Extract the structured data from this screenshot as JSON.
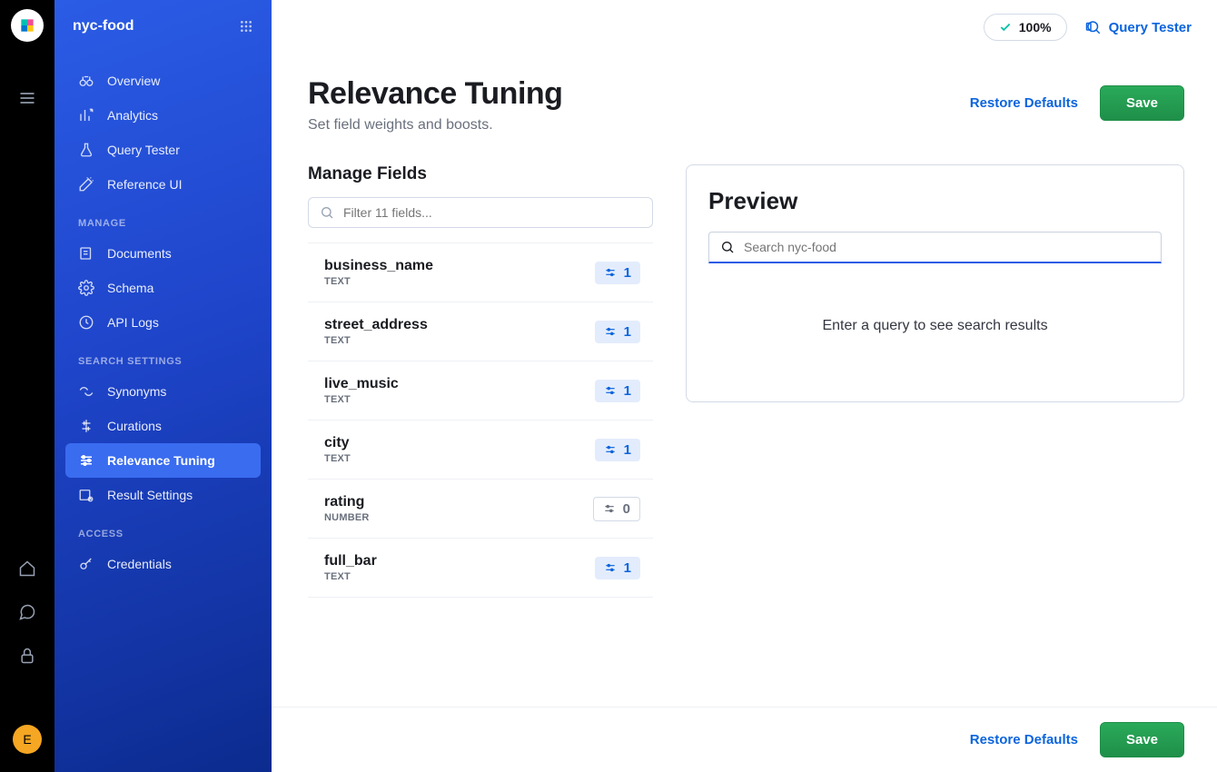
{
  "app_name": "nyc-food",
  "avatar_initial": "E",
  "topbar": {
    "pill_pct": "100%",
    "query_tester": "Query Tester"
  },
  "page": {
    "title": "Relevance Tuning",
    "subtitle": "Set field weights and boosts.",
    "restore": "Restore Defaults",
    "save": "Save"
  },
  "manage_fields": {
    "heading": "Manage Fields",
    "filter_placeholder": "Filter 11 fields...",
    "fields": [
      {
        "name": "business_name",
        "type": "TEXT",
        "weight": "1",
        "style": "blue"
      },
      {
        "name": "street_address",
        "type": "TEXT",
        "weight": "1",
        "style": "blue"
      },
      {
        "name": "live_music",
        "type": "TEXT",
        "weight": "1",
        "style": "blue"
      },
      {
        "name": "city",
        "type": "TEXT",
        "weight": "1",
        "style": "blue"
      },
      {
        "name": "rating",
        "type": "NUMBER",
        "weight": "0",
        "style": "gray"
      },
      {
        "name": "full_bar",
        "type": "TEXT",
        "weight": "1",
        "style": "blue"
      }
    ]
  },
  "preview": {
    "heading": "Preview",
    "placeholder": "Search nyc-food",
    "empty": "Enter a query to see search results"
  },
  "sidebar": {
    "top": [
      {
        "label": "Overview",
        "icon": "binoculars"
      },
      {
        "label": "Analytics",
        "icon": "analytics"
      },
      {
        "label": "Query Tester",
        "icon": "flask"
      },
      {
        "label": "Reference UI",
        "icon": "wand"
      }
    ],
    "groups": [
      {
        "label": "MANAGE",
        "items": [
          {
            "label": "Documents",
            "icon": "documents"
          },
          {
            "label": "Schema",
            "icon": "gear"
          },
          {
            "label": "API Logs",
            "icon": "clock"
          }
        ]
      },
      {
        "label": "SEARCH SETTINGS",
        "items": [
          {
            "label": "Synonyms",
            "icon": "synonyms"
          },
          {
            "label": "Curations",
            "icon": "curations"
          },
          {
            "label": "Relevance Tuning",
            "icon": "sliders",
            "active": true
          },
          {
            "label": "Result Settings",
            "icon": "result"
          }
        ]
      },
      {
        "label": "ACCESS",
        "items": [
          {
            "label": "Credentials",
            "icon": "key"
          }
        ]
      }
    ]
  }
}
